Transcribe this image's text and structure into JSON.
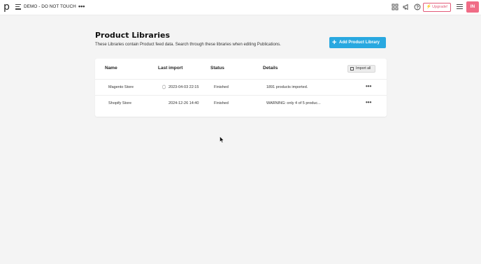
{
  "topbar": {
    "logo": "p",
    "workspace_name": "DEMO - DO NOT TOUCH",
    "workspace_more": "•••",
    "upgrade_label": "Upgrade!",
    "avatar_initials": "IN"
  },
  "page": {
    "title": "Product Libraries",
    "subtitle": "These Libraries contain Product feed data. Search through these libraries when editing Publications.",
    "add_button_label": "Add Product Library"
  },
  "table": {
    "columns": [
      "Name",
      "Last import",
      "Status",
      "Details"
    ],
    "import_all_label": "Import all",
    "rows": [
      {
        "name": "Magento Store",
        "last_import": "2023-04-03 22:15",
        "status": "Finished",
        "details": "1891 products imported.",
        "more": "•••"
      },
      {
        "name": "Shopify Store",
        "last_import": "2024-12-26 14:40",
        "status": "Finished",
        "details": "WARNING: only 4 of 5 produc...",
        "more": "•••"
      }
    ]
  },
  "colors": {
    "accent": "#29a8e0",
    "upgrade": "#e25a78",
    "avatar": "#f06c86"
  }
}
